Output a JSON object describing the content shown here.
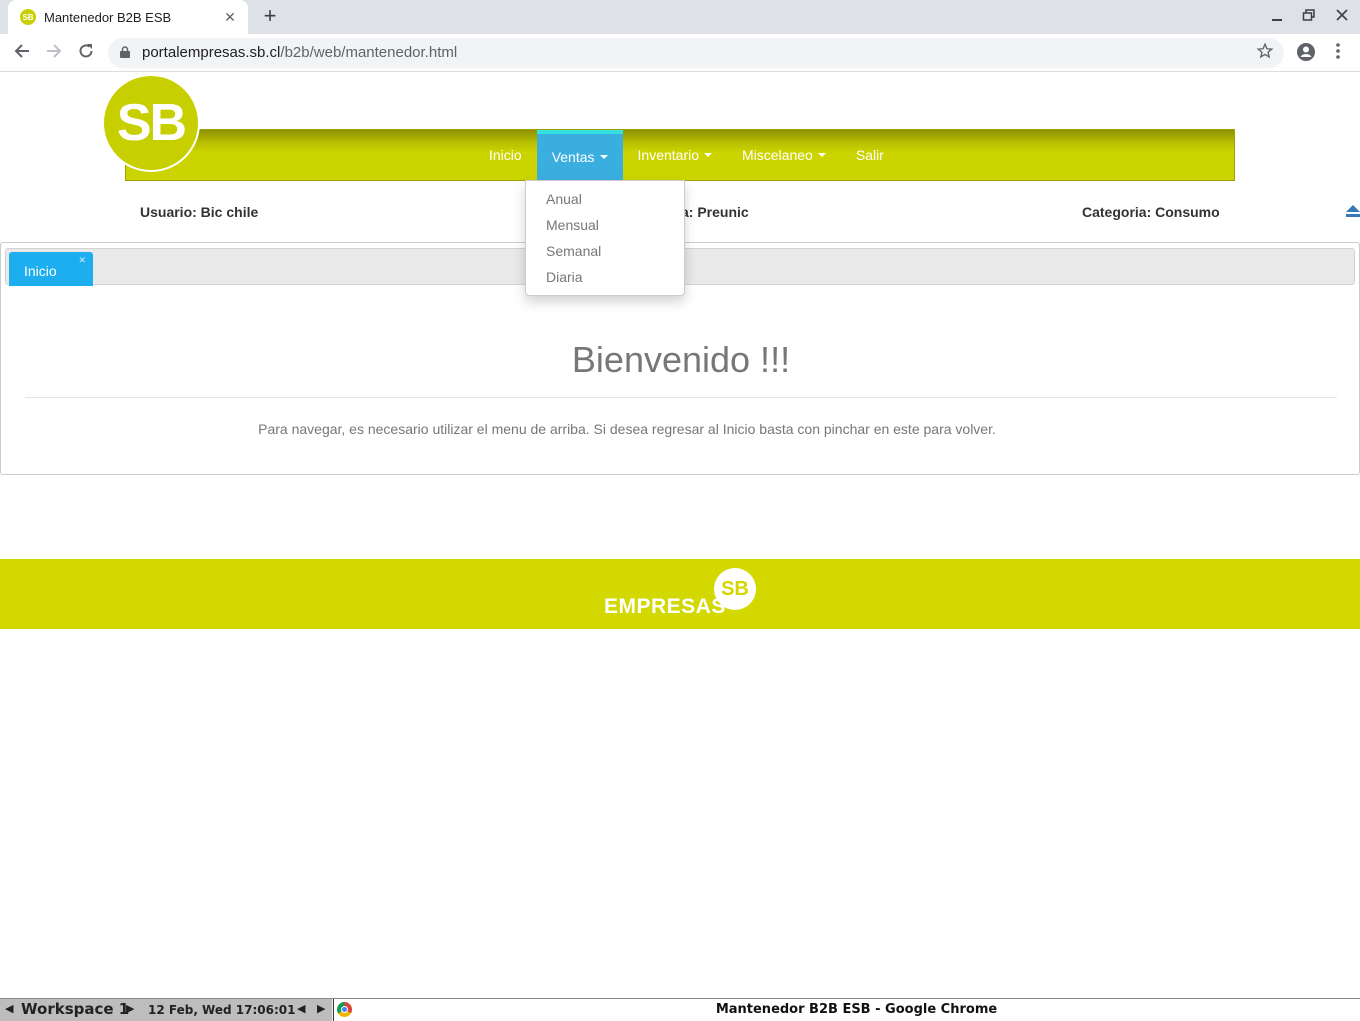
{
  "browser": {
    "tab_title": "Mantenedor B2B ESB",
    "favicon_text": "SB",
    "tab_close": "✕",
    "new_tab": "+",
    "url_host": "portalempresas.sb.cl",
    "url_path": "/b2b/web/mantenedor.html",
    "window_controls": [
      "minimize",
      "restore",
      "close"
    ]
  },
  "brand": {
    "logo_text": "SB",
    "accent_color": "#c8cf00",
    "active_tab_color": "#1caeef"
  },
  "nav": {
    "items": [
      {
        "label": "Inicio",
        "dropdown": false,
        "active": false
      },
      {
        "label": "Ventas",
        "dropdown": true,
        "active": true
      },
      {
        "label": "Inventario",
        "dropdown": true,
        "active": false
      },
      {
        "label": "Miscelaneo",
        "dropdown": true,
        "active": false
      },
      {
        "label": "Salir",
        "dropdown": false,
        "active": false
      }
    ],
    "open_dropdown": {
      "parent": "Ventas",
      "items": [
        "Anual",
        "Mensual",
        "Semanal",
        "Diaria"
      ]
    }
  },
  "info": {
    "usuario": "Usuario: Bic chile",
    "middle_visible": "a: Preunic",
    "categoria": "Categoria: Consumo"
  },
  "content": {
    "tab_label": "Inicio",
    "tab_close": "✕",
    "welcome": "Bienvenido !!!",
    "description": "Para navegar, es necesario utilizar el menu de arriba. Si desea regresar al Inicio basta con pinchar en este para volver."
  },
  "footer": {
    "brand_text": "EMPRESAS",
    "brand_badge": "SB"
  },
  "taskbar": {
    "workspace": "Workspace 1",
    "clock": "12 Feb, Wed 17:06:01",
    "task_title": "Mantenedor B2B ESB - Google Chrome"
  }
}
